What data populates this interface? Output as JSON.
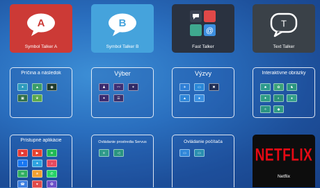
{
  "tiles": {
    "symbol_talker_a": {
      "label": "Symbol Talker A",
      "letter": "A",
      "color": "#cc3a36"
    },
    "symbol_talker_b": {
      "label": "Symbol Talker B",
      "letter": "B",
      "color": "#45a3dc"
    },
    "fast_talker": {
      "label": "Fast Talker",
      "color": "#2a3240"
    },
    "text_talker": {
      "label": "Text Talker",
      "letter": "T",
      "color": "#3a4148"
    },
    "netflix": {
      "label": "Netflix",
      "wordmark": "NETFLIX",
      "color": "#0d0d0d",
      "brand_red": "#e50914"
    }
  },
  "folders": {
    "pricina": {
      "title": "Príčina a následok",
      "item_count": 5
    },
    "vyber": {
      "title": "Výber",
      "item_count": 5
    },
    "vyzvy": {
      "title": "Výzvy",
      "item_count": 5
    },
    "interaktivne": {
      "title": "Interaktívne obrázky",
      "item_count": 8
    },
    "pristupne": {
      "title": "Prístupné aplikácie",
      "item_count": 12
    },
    "servus": {
      "title": "Ovládanie prostredia Servus",
      "item_count": 2
    },
    "pocitac": {
      "title": "Ovládanie počítača",
      "item_count": 2
    }
  },
  "fast_talker_icons": [
    "chat-bubble-icon",
    "red-square-icon",
    "teal-square-icon",
    "at-sign-icon"
  ]
}
